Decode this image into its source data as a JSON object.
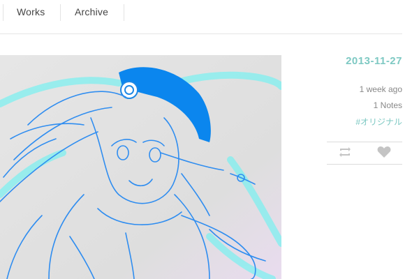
{
  "nav": {
    "items": [
      {
        "label": "Works"
      },
      {
        "label": "Archive"
      }
    ]
  },
  "post": {
    "date": "2013-11-27",
    "relative_time": "1 week ago",
    "notes": "1 Notes",
    "tag": "#オリジナル",
    "actions": [
      {
        "icon": "reblog-icon"
      },
      {
        "icon": "heart-icon"
      }
    ]
  },
  "colors": {
    "accent": "#7ec9c3",
    "sketch": "#2f8df0",
    "muted": "#888888"
  }
}
